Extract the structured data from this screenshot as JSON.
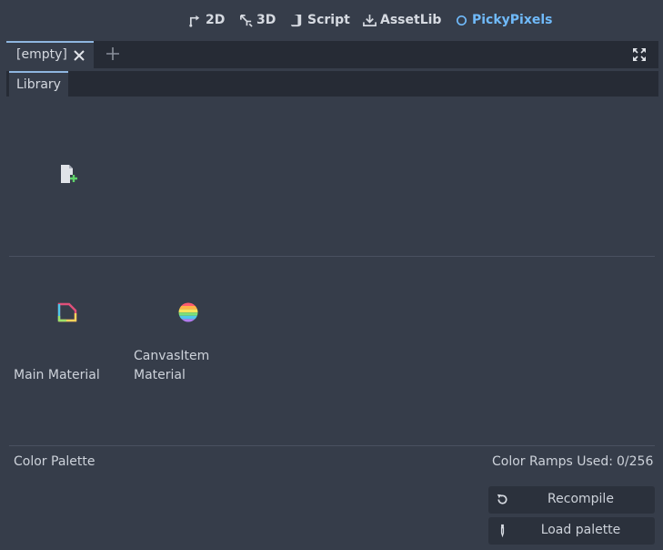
{
  "workspaces": [
    {
      "label": "2D",
      "icon": "2d-icon"
    },
    {
      "label": "3D",
      "icon": "3d-icon"
    },
    {
      "label": "Script",
      "icon": "script-icon"
    },
    {
      "label": "AssetLib",
      "icon": "assetlib-icon"
    },
    {
      "label": "PickyPixels",
      "icon": "plugin-circle-icon",
      "active": true
    }
  ],
  "tabs": {
    "current": "[empty]",
    "icons": [
      "close-icon",
      "add-tab-icon",
      "distraction-free-icon"
    ]
  },
  "library": {
    "tab_label": "Library",
    "new_item_icon": "new-file-icon",
    "materials": [
      {
        "label": "Main Material",
        "icon": "material-icon"
      },
      {
        "label": "CanvasItem\nMaterial",
        "icon": "rainbow-sphere-icon"
      }
    ]
  },
  "palette": {
    "title": "Color Palette",
    "ramps_used_label": "Color Ramps Used:",
    "ramps_used_value": "0/256",
    "recompile_label": "Recompile",
    "load_palette_label": "Load palette"
  },
  "colors": {
    "background": "#363d4a",
    "dark": "#262b35",
    "accent": "#70bafa",
    "button": "#2b313c"
  }
}
